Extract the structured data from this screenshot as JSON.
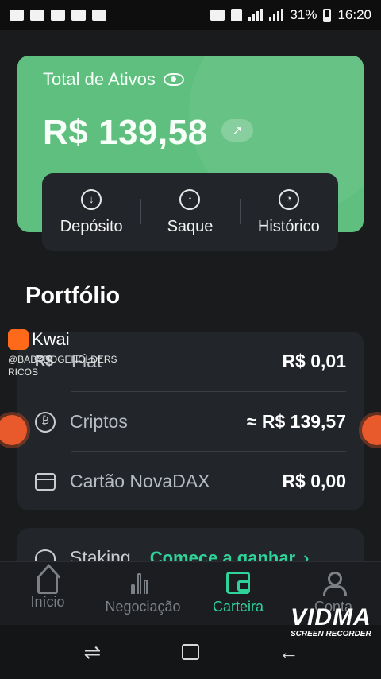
{
  "status_bar": {
    "battery": "31%",
    "time": "16:20"
  },
  "assets": {
    "title": "Total de Ativos",
    "value": "R$ 139,58"
  },
  "actions": [
    {
      "label": "Depósito",
      "icon": "download-icon"
    },
    {
      "label": "Saque",
      "icon": "upload-icon"
    },
    {
      "label": "Histórico",
      "icon": "history-icon"
    }
  ],
  "portfolio": {
    "title": "Portfólio",
    "rows": [
      {
        "label": "Fiat",
        "value": "R$ 0,01",
        "icon": "fiat-icon"
      },
      {
        "label": "Criptos",
        "value": "≈ R$ 139,57",
        "icon": "crypto-coin-icon"
      },
      {
        "label": "Cartão NovaDAX",
        "value": "R$ 0,00",
        "icon": "card-icon"
      }
    ]
  },
  "staking": {
    "label": "Staking",
    "link": "Comece a ganhar"
  },
  "nav": [
    {
      "label": "Início",
      "icon": "home-icon",
      "active": false
    },
    {
      "label": "Negociação",
      "icon": "chart-bars-icon",
      "active": false
    },
    {
      "label": "Carteira",
      "icon": "wallet-icon",
      "active": true
    },
    {
      "label": "Conta",
      "icon": "user-icon",
      "active": false
    }
  ],
  "overlay": {
    "kwai_name": "Kwai",
    "kwai_user": "@BABYDOGEHOLDERS RICOS",
    "recorder_name": "VIDMA",
    "recorder_sub": "SCREEN RECORDER"
  },
  "colors": {
    "card_green": "#5fbf7f",
    "accent": "#2fd39a",
    "background": "#1a1b1d",
    "panel": "#222529"
  }
}
